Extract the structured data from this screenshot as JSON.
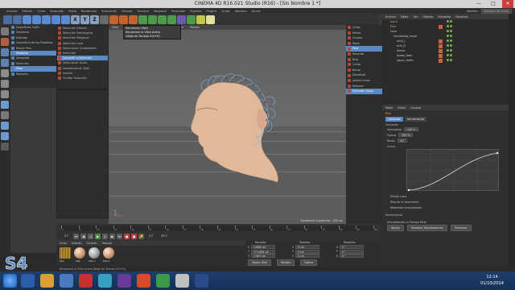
{
  "window": {
    "title": "CINEMA 4D R16.021 Studio (R16) - [Sin Nombre 1 *]",
    "minimize": "—",
    "maximize": "□",
    "close": "✕"
  },
  "menubar": {
    "items": [
      "Archivo",
      "Edición",
      "Crear",
      "Selección",
      "Malla",
      "Renderizar",
      "Animación",
      "Simular",
      "Esculpir",
      "Mograph",
      "Personaje",
      "Pipeline",
      "Plugins",
      "Script",
      "Ventana",
      "Ayuda"
    ],
    "layout_label": "Interfaz:",
    "layout_value": "Entorno de Inicio"
  },
  "toolbar": {
    "x": "X",
    "y": "Y",
    "z": "Z"
  },
  "tooltip": {
    "line1": "Renderizar Vista",
    "line2": "Renderizar la Vista Activa",
    "line3": "(Atajo de Teclado Ctrl+R)"
  },
  "left_panel": {
    "items": [
      "Superficies Cloth",
      "Dinámica",
      "Estirado",
      "Geometría de las Pestañas",
      "Añadir Pelo",
      "Pestañas",
      "Densidad",
      "Dirección",
      "Pelar",
      "Rotación"
    ]
  },
  "submenu": {
    "items": [
      "Selección Directa",
      "Selección Rectangular",
      "Selección Poligonal",
      "Selección Lazo",
      "Seleccionar Linealmente",
      "Selección",
      "Convertir a Selección",
      "Seleccionar Guías",
      "Deseleccionar Todo",
      "Invertir",
      "Ocultar Selección"
    ]
  },
  "viewport": {
    "menu": [
      "Vista",
      "Cámaras",
      "Mostrar",
      "Opciones",
      "Filtro",
      "Paneles"
    ],
    "status": "Espaciado Cuadrícula : 100 cm"
  },
  "object_manager_left": {
    "items": [
      "Guías",
      "Mover",
      "Escalar",
      "Rotar",
      "Pelo",
      "Recortar",
      "Rizo",
      "Cortar",
      "Borrar",
      "Densidad",
      "Añadir Guías",
      "Rellenar",
      "Extender Guías"
    ]
  },
  "objects_panel": {
    "menu": [
      "Archivo",
      "Editar",
      "Ver",
      "Objetos",
      "Etiquetas",
      "Favoritos"
    ],
    "tree": [
      "Luz.1",
      "Pelo",
      "Cara",
      "Hairstyling_mask",
      "skull_L",
      "skin_B",
      "lentes",
      "brows_bath",
      "upper_teeth"
    ]
  },
  "attributes": {
    "menu": [
      "Modo",
      "Editar",
      "Usuario"
    ],
    "object": "Pelo",
    "tabs": [
      "Opciones",
      "Herramienta"
    ],
    "section": "Opciones",
    "fields": [
      {
        "label": "Intensidad",
        "value": "100 %"
      },
      {
        "label": "Fuerza",
        "value": "100 %"
      },
      {
        "label": "Radio",
        "value": "40"
      },
      {
        "label": "Curva",
        "value": ""
      }
    ],
    "checkboxes": [
      "Dividir Lazo",
      "Pelo de la Geometría",
      "Mantener Interpolación"
    ],
    "subsection": "Herramienta",
    "actions": [
      "Actualización al Tiempo Real",
      "Aplicar",
      "Resetear Transformación",
      "Restaurar"
    ]
  },
  "timeline": {
    "start": "0 F",
    "end": "90 F",
    "frame": "0 F",
    "ticks": [
      "0",
      "5",
      "10",
      "15",
      "20",
      "25",
      "30",
      "35",
      "40",
      "45",
      "50",
      "55",
      "60",
      "65",
      "70",
      "75",
      "80",
      "85",
      "90"
    ]
  },
  "materials": {
    "menu": [
      "Crear",
      "Edición",
      "Función",
      "Textura"
    ],
    "items": [
      "Pelo",
      "Mat",
      "Mat.1",
      "Mat.2"
    ]
  },
  "coordinates": {
    "headers": [
      "Posición",
      "Tamaño",
      "Rotación"
    ],
    "rows": [
      {
        "p": "1.696 cm",
        "s": "0 cm",
        "r": "0 °",
        "axp": "X",
        "axs": "X",
        "axr": "H"
      },
      {
        "p": "171.609 cm",
        "s": "0 cm",
        "r": "0 °",
        "axp": "Y",
        "axs": "Y",
        "axr": "P"
      },
      {
        "p": "1.567 cm",
        "s": "0 cm",
        "r": "0 °",
        "axp": "Z",
        "axs": "Z",
        "axr": "B"
      }
    ],
    "mode": "Objeto (Rel)",
    "size_mode": "Tamaño",
    "apply": "Aplicar"
  },
  "statusbar": {
    "text": "Renderizar la Vista Activa (Atajo de Teclado Ctrl+R)"
  },
  "clock": {
    "time": "12:14",
    "date": "01/10/2014"
  },
  "colors": {
    "accent": "#5b89c4",
    "taskbar": "#15305a",
    "skin": "#e0b89a"
  }
}
